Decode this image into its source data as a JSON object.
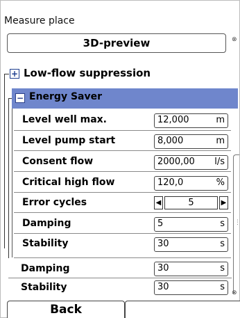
{
  "screen": {
    "title": "Measure place"
  },
  "preview_button": {
    "label": "3D-preview"
  },
  "groups": {
    "low_flow": {
      "label": "Low-flow suppression",
      "state": "collapsed",
      "icon": "plus-icon"
    },
    "energy_saver": {
      "label": "Energy Saver",
      "state": "expanded",
      "icon": "minus-icon",
      "header_color": "#6f86cc",
      "rows": [
        {
          "label": "Level well max.",
          "value": "12,000",
          "unit": "m"
        },
        {
          "label": "Level pump start",
          "value": "8,000",
          "unit": "m"
        },
        {
          "label": "Consent flow",
          "value": "2000,00",
          "unit": "l/s"
        },
        {
          "label": "Critical high flow",
          "value": "120,0",
          "unit": "%"
        },
        {
          "label": "Error cycles",
          "value": "5",
          "unit": ""
        },
        {
          "label": "Damping",
          "value": "5",
          "unit": "s"
        },
        {
          "label": "Stability",
          "value": "30",
          "unit": "s"
        }
      ]
    }
  },
  "outer_rows": [
    {
      "label": "Damping",
      "value": "30",
      "unit": "s"
    },
    {
      "label": "Stability",
      "value": "30",
      "unit": "s"
    }
  ],
  "softkeys": {
    "left": "Back",
    "right": ""
  }
}
